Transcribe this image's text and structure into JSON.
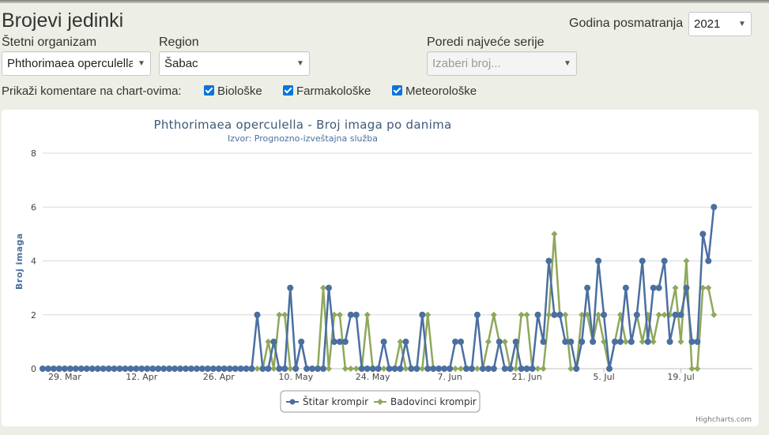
{
  "page": {
    "title": "Brojevi jedinki",
    "year_label": "Godina posmatranja",
    "year_value": "2021",
    "organism_label": "Štetni organizam",
    "organism_value": "Phthorimaea operculella",
    "region_label": "Region",
    "region_value": "Šabac",
    "compare_label": "Poredi najveće serije",
    "compare_placeholder": "Izaberi broj...",
    "comments_label": "Prikaži komentare na chart-ovima:",
    "checkboxes": [
      "Biološke",
      "Farmakološke",
      "Meteorološke"
    ]
  },
  "colors": {
    "series1": "#4a6fa0",
    "series2": "#8fa85a",
    "title": "#3e5a79",
    "checkbox": "#0a74da"
  },
  "chart_data": {
    "type": "line",
    "title": "Phthorimaea operculella - Broj imaga po danima",
    "subtitle": "Izvor: Prognozno-izveštajna služba",
    "ylabel": "Broj imaga",
    "xlabel": "",
    "x_ticks": [
      "29. Mar",
      "12. Apr",
      "26. Apr",
      "10. May",
      "24. May",
      "7. Jun",
      "21. Jun",
      "5. Jul",
      "19. Jul"
    ],
    "y_ticks": [
      0,
      2,
      4,
      6,
      8
    ],
    "ylim": [
      0,
      8
    ],
    "xlim_days": [
      0,
      129
    ],
    "grid": true,
    "legend": "bottom-center",
    "credits": "Highcharts.com",
    "series": [
      {
        "name": "Štitar krompir",
        "marker": "circle",
        "points": [
          [
            0,
            0
          ],
          [
            1,
            0
          ],
          [
            2,
            0
          ],
          [
            3,
            0
          ],
          [
            4,
            0
          ],
          [
            5,
            0
          ],
          [
            6,
            0
          ],
          [
            7,
            0
          ],
          [
            8,
            0
          ],
          [
            9,
            0
          ],
          [
            10,
            0
          ],
          [
            11,
            0
          ],
          [
            12,
            0
          ],
          [
            13,
            0
          ],
          [
            14,
            0
          ],
          [
            15,
            0
          ],
          [
            16,
            0
          ],
          [
            17,
            0
          ],
          [
            18,
            0
          ],
          [
            19,
            0
          ],
          [
            20,
            0
          ],
          [
            21,
            0
          ],
          [
            22,
            0
          ],
          [
            23,
            0
          ],
          [
            24,
            0
          ],
          [
            25,
            0
          ],
          [
            26,
            0
          ],
          [
            27,
            0
          ],
          [
            28,
            0
          ],
          [
            29,
            0
          ],
          [
            30,
            0
          ],
          [
            31,
            0
          ],
          [
            32,
            0
          ],
          [
            33,
            0
          ],
          [
            34,
            0
          ],
          [
            35,
            0
          ],
          [
            36,
            0
          ],
          [
            37,
            0
          ],
          [
            38,
            0
          ],
          [
            39,
            2
          ],
          [
            40,
            0
          ],
          [
            41,
            0
          ],
          [
            42,
            1
          ],
          [
            43,
            0
          ],
          [
            44,
            0
          ],
          [
            45,
            3
          ],
          [
            46,
            0
          ],
          [
            47,
            1
          ],
          [
            48,
            0
          ],
          [
            49,
            0
          ],
          [
            50,
            0
          ],
          [
            51,
            0
          ],
          [
            52,
            3
          ],
          [
            53,
            1
          ],
          [
            54,
            1
          ],
          [
            55,
            1
          ],
          [
            56,
            2
          ],
          [
            57,
            2
          ],
          [
            58,
            0
          ],
          [
            59,
            0
          ],
          [
            60,
            0
          ],
          [
            61,
            0
          ],
          [
            62,
            1
          ],
          [
            63,
            0
          ],
          [
            64,
            0
          ],
          [
            65,
            0
          ],
          [
            66,
            1
          ],
          [
            67,
            0
          ],
          [
            68,
            0
          ],
          [
            69,
            2
          ],
          [
            70,
            0
          ],
          [
            71,
            0
          ],
          [
            72,
            0
          ],
          [
            73,
            0
          ],
          [
            74,
            0
          ],
          [
            75,
            1
          ],
          [
            76,
            1
          ],
          [
            77,
            0
          ],
          [
            78,
            0
          ],
          [
            79,
            2
          ],
          [
            80,
            0
          ],
          [
            81,
            0
          ],
          [
            82,
            0
          ],
          [
            83,
            1
          ],
          [
            84,
            0
          ],
          [
            85,
            0
          ],
          [
            86,
            1
          ],
          [
            87,
            0
          ],
          [
            88,
            0
          ],
          [
            89,
            0
          ],
          [
            90,
            2
          ],
          [
            91,
            1
          ],
          [
            92,
            4
          ],
          [
            93,
            2
          ],
          [
            94,
            2
          ],
          [
            95,
            1
          ],
          [
            96,
            1
          ],
          [
            97,
            0
          ],
          [
            98,
            1
          ],
          [
            99,
            3
          ],
          [
            100,
            1
          ],
          [
            101,
            4
          ],
          [
            102,
            2
          ],
          [
            103,
            0
          ],
          [
            104,
            1
          ],
          [
            105,
            1
          ],
          [
            106,
            3
          ],
          [
            107,
            1
          ],
          [
            108,
            2
          ],
          [
            109,
            4
          ],
          [
            110,
            1
          ],
          [
            111,
            3
          ],
          [
            112,
            3
          ],
          [
            113,
            4
          ],
          [
            114,
            1
          ],
          [
            115,
            2
          ],
          [
            116,
            2
          ],
          [
            117,
            3
          ],
          [
            118,
            1
          ],
          [
            119,
            1
          ],
          [
            120,
            5
          ],
          [
            121,
            4
          ],
          [
            122,
            6
          ]
        ]
      },
      {
        "name": "Badovinci krompir",
        "marker": "diamond",
        "points": [
          [
            0,
            0
          ],
          [
            1,
            0
          ],
          [
            2,
            0
          ],
          [
            3,
            0
          ],
          [
            4,
            0
          ],
          [
            5,
            0
          ],
          [
            6,
            0
          ],
          [
            7,
            0
          ],
          [
            8,
            0
          ],
          [
            9,
            0
          ],
          [
            10,
            0
          ],
          [
            11,
            0
          ],
          [
            12,
            0
          ],
          [
            13,
            0
          ],
          [
            14,
            0
          ],
          [
            15,
            0
          ],
          [
            16,
            0
          ],
          [
            17,
            0
          ],
          [
            18,
            0
          ],
          [
            19,
            0
          ],
          [
            20,
            0
          ],
          [
            21,
            0
          ],
          [
            22,
            0
          ],
          [
            23,
            0
          ],
          [
            24,
            0
          ],
          [
            25,
            0
          ],
          [
            26,
            0
          ],
          [
            27,
            0
          ],
          [
            28,
            0
          ],
          [
            29,
            0
          ],
          [
            30,
            0
          ],
          [
            31,
            0
          ],
          [
            32,
            0
          ],
          [
            33,
            0
          ],
          [
            34,
            0
          ],
          [
            35,
            0
          ],
          [
            36,
            0
          ],
          [
            37,
            0
          ],
          [
            38,
            0
          ],
          [
            39,
            0
          ],
          [
            40,
            0
          ],
          [
            41,
            1
          ],
          [
            42,
            0
          ],
          [
            43,
            2
          ],
          [
            44,
            2
          ],
          [
            45,
            0
          ],
          [
            46,
            0
          ],
          [
            47,
            1
          ],
          [
            48,
            0
          ],
          [
            49,
            0
          ],
          [
            50,
            0
          ],
          [
            51,
            3
          ],
          [
            52,
            0
          ],
          [
            53,
            2
          ],
          [
            54,
            2
          ],
          [
            55,
            0
          ],
          [
            56,
            0
          ],
          [
            57,
            0
          ],
          [
            58,
            0
          ],
          [
            59,
            2
          ],
          [
            60,
            0
          ],
          [
            61,
            0
          ],
          [
            62,
            0
          ],
          [
            63,
            0
          ],
          [
            64,
            0
          ],
          [
            65,
            1
          ],
          [
            66,
            0
          ],
          [
            67,
            0
          ],
          [
            68,
            0
          ],
          [
            69,
            0
          ],
          [
            70,
            2
          ],
          [
            71,
            0
          ],
          [
            72,
            0
          ],
          [
            73,
            0
          ],
          [
            74,
            0
          ],
          [
            75,
            0
          ],
          [
            76,
            0
          ],
          [
            77,
            0
          ],
          [
            78,
            0
          ],
          [
            79,
            0
          ],
          [
            80,
            0
          ],
          [
            81,
            1
          ],
          [
            82,
            2
          ],
          [
            83,
            1
          ],
          [
            84,
            1
          ],
          [
            85,
            0
          ],
          [
            86,
            0
          ],
          [
            87,
            2
          ],
          [
            88,
            2
          ],
          [
            89,
            0
          ],
          [
            90,
            0
          ],
          [
            91,
            0
          ],
          [
            92,
            2
          ],
          [
            93,
            5
          ],
          [
            94,
            2
          ],
          [
            95,
            2
          ],
          [
            96,
            0
          ],
          [
            97,
            0
          ],
          [
            98,
            2
          ],
          [
            99,
            2
          ],
          [
            100,
            1
          ],
          [
            101,
            2
          ],
          [
            102,
            1
          ],
          [
            103,
            0
          ],
          [
            104,
            1
          ],
          [
            105,
            2
          ],
          [
            106,
            1
          ],
          [
            107,
            1
          ],
          [
            108,
            2
          ],
          [
            109,
            1
          ],
          [
            110,
            2
          ],
          [
            111,
            1
          ],
          [
            112,
            2
          ],
          [
            113,
            2
          ],
          [
            114,
            2
          ],
          [
            115,
            3
          ],
          [
            116,
            1
          ],
          [
            117,
            4
          ],
          [
            118,
            0
          ],
          [
            119,
            0
          ],
          [
            120,
            3
          ],
          [
            121,
            3
          ],
          [
            122,
            2
          ]
        ]
      }
    ]
  }
}
